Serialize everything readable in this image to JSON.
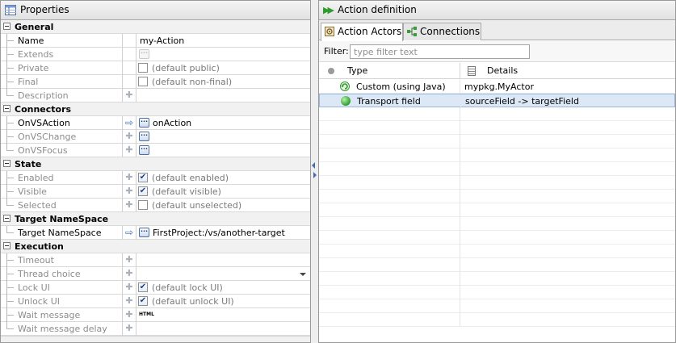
{
  "properties": {
    "title": "Properties",
    "categories": [
      {
        "label": "General",
        "rows": [
          {
            "label": "Name",
            "value": "my-Action"
          },
          {
            "label": "Extends"
          },
          {
            "label": "Private",
            "value": "(default public)"
          },
          {
            "label": "Final",
            "value": "(default non-final)"
          },
          {
            "label": "Description"
          }
        ]
      },
      {
        "label": "Connectors",
        "rows": [
          {
            "label": "OnVSAction",
            "value": "onAction"
          },
          {
            "label": "OnVSChange"
          },
          {
            "label": "OnVSFocus"
          }
        ]
      },
      {
        "label": "State",
        "rows": [
          {
            "label": "Enabled",
            "value": "(default enabled)",
            "checked": true
          },
          {
            "label": "Visible",
            "value": "(default visible)",
            "checked": true
          },
          {
            "label": "Selected",
            "value": "(default unselected)",
            "checked": false
          }
        ]
      },
      {
        "label": "Target NameSpace",
        "rows": [
          {
            "label": "Target NameSpace",
            "value": "FirstProject:/vs/another-target"
          }
        ]
      },
      {
        "label": "Execution",
        "rows": [
          {
            "label": "Timeout"
          },
          {
            "label": "Thread choice"
          },
          {
            "label": "Lock UI",
            "value": "(default lock UI)",
            "checked": true
          },
          {
            "label": "Unlock UI",
            "value": "(default unlock UI)",
            "checked": true
          },
          {
            "label": "Wait message",
            "value": "HTML"
          },
          {
            "label": "Wait message delay"
          }
        ]
      }
    ]
  },
  "action_definition": {
    "title": "Action definition",
    "tabs": [
      {
        "label": "Action Actors",
        "active": true
      },
      {
        "label": "Connections",
        "active": false
      }
    ],
    "filter": {
      "label": "Filter:",
      "placeholder": "type filter text",
      "value": ""
    },
    "columns": {
      "type": "Type",
      "details": "Details"
    },
    "rows": [
      {
        "type": "Custom (using Java)",
        "details": "mypkg.MyActor",
        "icon": "refresh-icon",
        "selected": false
      },
      {
        "type": "Transport field",
        "details": "sourceField -> targetField",
        "icon": "green-dot-icon",
        "selected": true
      }
    ]
  },
  "colors": {
    "accent_green": "#2f9a2f",
    "selection": "#dde8f6",
    "link_blue": "#3f6dbf"
  }
}
